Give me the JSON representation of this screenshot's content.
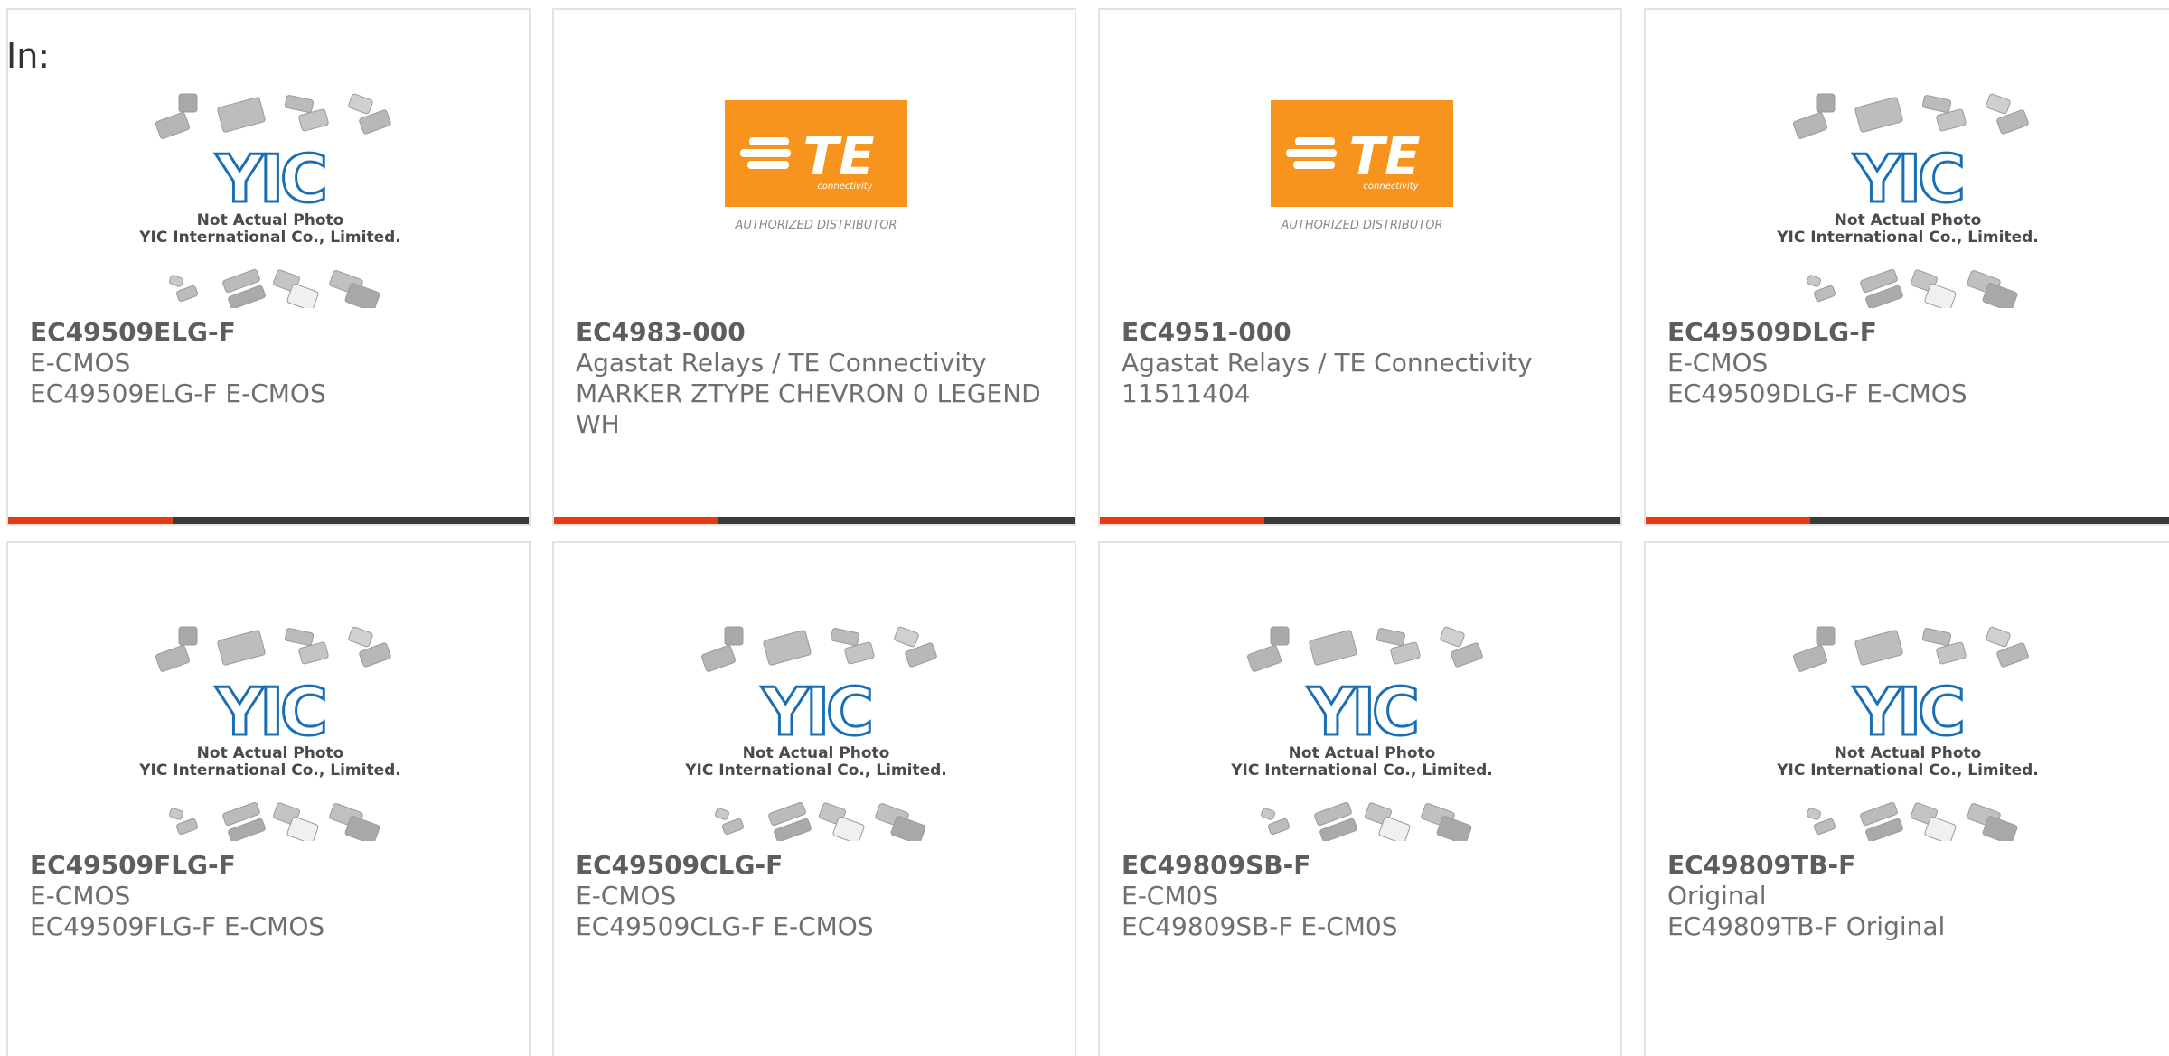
{
  "header": {
    "in_label": "In:"
  },
  "placeholder": {
    "logo_text": "YIC",
    "line1": "Not Actual Photo",
    "line2": "YIC International Co., Limited.",
    "logo_color": "#1a6fb4"
  },
  "te_logo": {
    "brand": "TE",
    "sub": "connectivity",
    "tagline": "AUTHORIZED DISTRIBUTOR",
    "bg_color": "#f7941d"
  },
  "accent_color": "#e83a10",
  "products": [
    {
      "part": "EC49509ELG-F",
      "manufacturer": "E-CMOS",
      "description": "EC49509ELG-F E-CMOS",
      "image": "yic"
    },
    {
      "part": "EC4983-000",
      "manufacturer": "Agastat Relays / TE Connectivity",
      "description": "MARKER ZTYPE CHEVRON 0 LEGEND WH",
      "image": "te"
    },
    {
      "part": "EC4951-000",
      "manufacturer": "Agastat Relays / TE Connectivity",
      "description": "11511404",
      "image": "te"
    },
    {
      "part": "EC49509DLG-F",
      "manufacturer": "E-CMOS",
      "description": "EC49509DLG-F E-CMOS",
      "image": "yic"
    },
    {
      "part": "EC49509FLG-F",
      "manufacturer": "E-CMOS",
      "description": "EC49509FLG-F E-CMOS",
      "image": "yic"
    },
    {
      "part": "EC49509CLG-F",
      "manufacturer": "E-CMOS",
      "description": "EC49509CLG-F E-CMOS",
      "image": "yic"
    },
    {
      "part": "EC49809SB-F",
      "manufacturer": "E-CM0S",
      "description": "EC49809SB-F E-CM0S",
      "image": "yic"
    },
    {
      "part": "EC49809TB-F",
      "manufacturer": "Original",
      "description": "EC49809TB-F Original",
      "image": "yic"
    }
  ]
}
